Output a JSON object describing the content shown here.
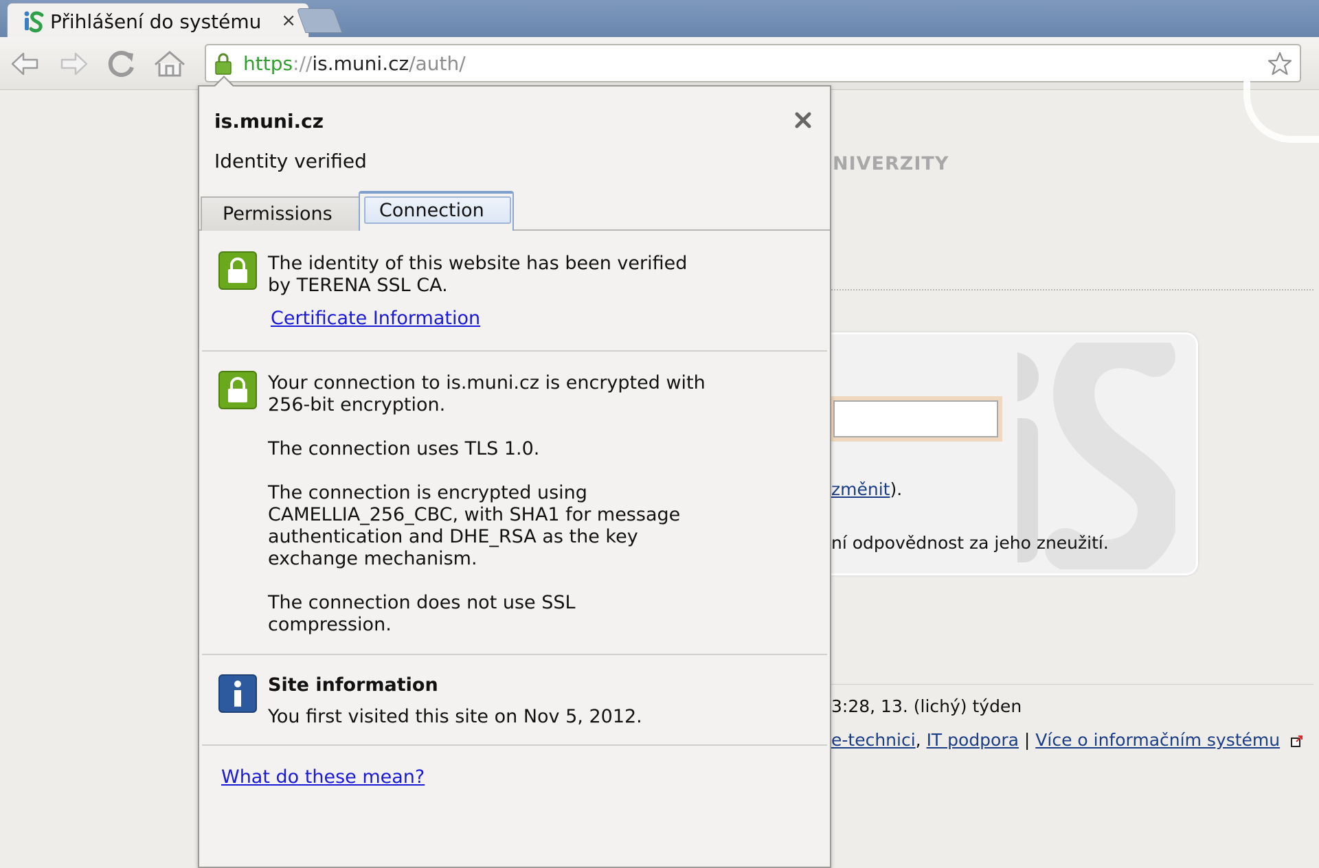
{
  "tab": {
    "title": "Přihlášení do systému",
    "close_glyph": "×"
  },
  "address_bar": {
    "scheme": "https",
    "separator": "://",
    "host": "is.muni.cz",
    "path": "/auth/"
  },
  "page": {
    "heading_fragment": "NIVERZITY",
    "login_line1_link": "změnit",
    "login_line1_tail": ").",
    "login_line2": "ní odpovědnost za jeho zneužití.",
    "footer_time": "3:28, 13. (lichý) týden",
    "footer_link1": "e-technici",
    "footer_sep1": ", ",
    "footer_link2": "IT podpora",
    "footer_sep2": " | ",
    "footer_link3": "Více o informačním systému"
  },
  "popup": {
    "host": "is.muni.cz",
    "status": "Identity verified",
    "tabs": {
      "permissions": "Permissions",
      "connection": "Connection"
    },
    "identity": {
      "line1": "The identity of this website has been verified",
      "line2": "by TERENA SSL CA.",
      "link": "Certificate Information"
    },
    "encryption": {
      "line1": "Your connection to is.muni.cz is encrypted with",
      "line2": "256-bit encryption.",
      "protocol": "The connection uses TLS 1.0.",
      "cipher1": "The connection is encrypted using",
      "cipher2": "CAMELLIA_256_CBC, with SHA1 for message",
      "cipher3": "authentication and DHE_RSA as the key",
      "cipher4": "exchange mechanism.",
      "compression1": "The connection does not use SSL",
      "compression2": "compression."
    },
    "site_info": {
      "title": "Site information",
      "text": "You first visited this site on Nov 5, 2012."
    },
    "help_link": "What do these mean?"
  },
  "colors": {
    "tabstrip": "#6a86ad",
    "https_green": "#2f9e2f",
    "link_blue": "#1a1ad6",
    "lock_green": "#6aa81e",
    "info_blue": "#2d5a9e"
  },
  "icons": [
    "is-logo-icon",
    "close-icon",
    "back-icon",
    "forward-icon",
    "reload-icon",
    "home-icon",
    "lock-icon",
    "star-icon",
    "info-icon",
    "external-link-icon"
  ]
}
